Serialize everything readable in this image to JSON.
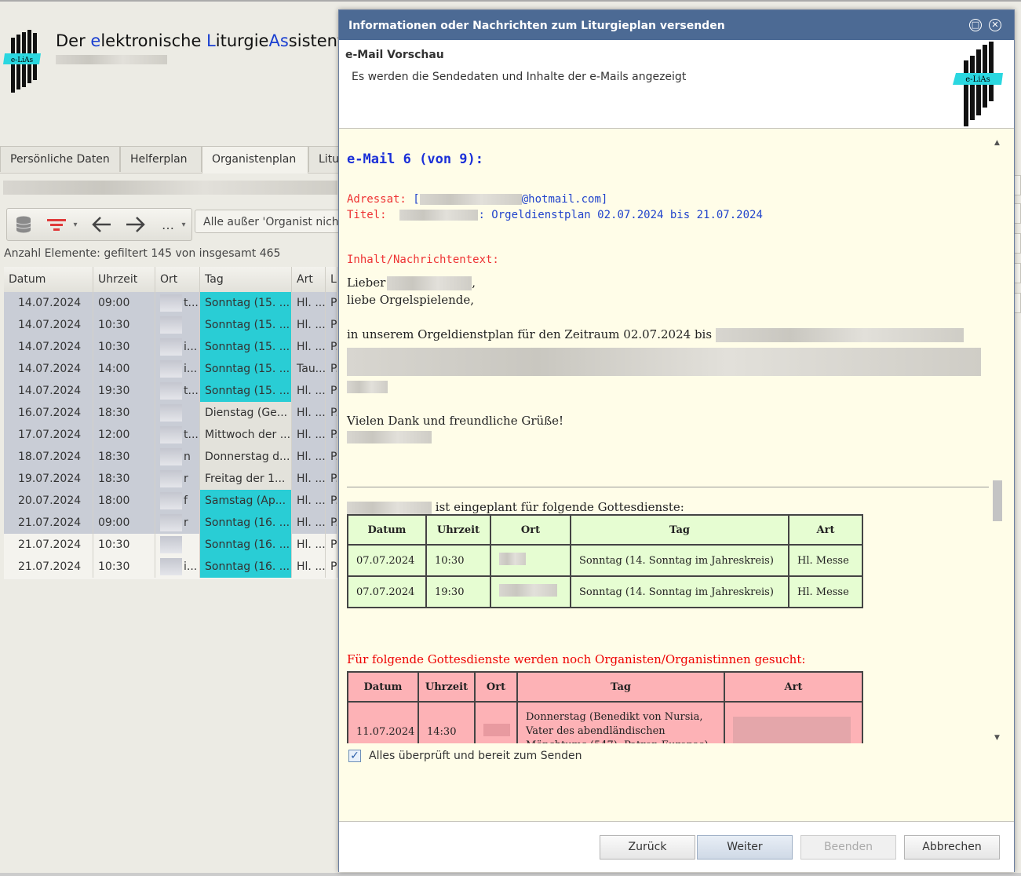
{
  "app": {
    "title_parts": [
      "Der ",
      "e",
      "lektronische ",
      "L",
      "iturgie",
      "As",
      "sistent"
    ],
    "logo_text": "e-LiAs"
  },
  "tabs": [
    "Persönliche Daten",
    "Helferplan",
    "Organistenplan",
    "Litu"
  ],
  "filter_text": "Alle außer 'Organist nich",
  "count_text": "Anzahl Elemente: gefiltert 145 von insgesamt 465",
  "grid": {
    "columns": [
      "Datum",
      "Uhrzeit",
      "Ort",
      "Tag",
      "Art",
      "Li"
    ],
    "rows": [
      {
        "datum": "14.07.2024",
        "uhrzeit": "09:00",
        "ort": "t...",
        "tag": "Sonntag (15. ...",
        "art": "Hl. ...",
        "li": "Pf"
      },
      {
        "datum": "14.07.2024",
        "uhrzeit": "10:30",
        "ort": "",
        "tag": "Sonntag (15. ...",
        "art": "Hl. ...",
        "li": "Pf"
      },
      {
        "datum": "14.07.2024",
        "uhrzeit": "10:30",
        "ort": "i...",
        "tag": "Sonntag (15. ...",
        "art": "Hl. ...",
        "li": "P."
      },
      {
        "datum": "14.07.2024",
        "uhrzeit": "14:00",
        "ort": "i...",
        "tag": "Sonntag (15. ...",
        "art": "Tau...",
        "li": "P."
      },
      {
        "datum": "14.07.2024",
        "uhrzeit": "19:30",
        "ort": "t...",
        "tag": "Sonntag (15. ...",
        "art": "Hl. ...",
        "li": "Pf"
      },
      {
        "datum": "16.07.2024",
        "uhrzeit": "18:30",
        "ort": "",
        "tag": "Dienstag (Ge...",
        "art": "Hl. ...",
        "li": "P."
      },
      {
        "datum": "17.07.2024",
        "uhrzeit": "12:00",
        "ort": "t...",
        "tag": "Mittwoch der ...",
        "art": "Hl. ...",
        "li": "P."
      },
      {
        "datum": "18.07.2024",
        "uhrzeit": "18:30",
        "ort": "n",
        "tag": "Donnerstag d...",
        "art": "Hl. ...",
        "li": "P."
      },
      {
        "datum": "19.07.2024",
        "uhrzeit": "18:30",
        "ort": "r",
        "tag": "Freitag der 1...",
        "art": "Hl. ...",
        "li": "P."
      },
      {
        "datum": "20.07.2024",
        "uhrzeit": "18:00",
        "ort": "f",
        "tag": "Samstag (Ap...",
        "art": "Hl. ...",
        "li": "P."
      },
      {
        "datum": "21.07.2024",
        "uhrzeit": "09:00",
        "ort": "r",
        "tag": "Sonntag (16. ...",
        "art": "Hl. ...",
        "li": "P."
      },
      {
        "datum": "21.07.2024",
        "uhrzeit": "10:30",
        "ort": "",
        "tag": "Sonntag (16. ...",
        "art": "Hl. ...",
        "li": "Pf"
      },
      {
        "datum": "21.07.2024",
        "uhrzeit": "10:30",
        "ort": "i...",
        "tag": "Sonntag (16. ...",
        "art": "Hl. ...",
        "li": "Pf"
      }
    ]
  },
  "dialog": {
    "title": "Informationen oder Nachrichten zum Liturgieplan versenden",
    "preview_title": "e-Mail Vorschau",
    "preview_sub": "Es werden die Sendedaten und Inhalte der e-Mails angezeigt",
    "logo_text": "e-LiAs",
    "checkbox_label": "Alles überprüft und bereit zum Senden",
    "buttons": {
      "back": "Zurück",
      "next": "Weiter",
      "finish": "Beenden",
      "cancel": "Abbrechen"
    }
  },
  "mail": {
    "heading": "e-Mail 6 (von 9):",
    "adressat_label": "Adressat:",
    "adressat_value": "@hotmail.com]",
    "titel_label": "Titel:",
    "titel_value": ": Orgeldienstplan 02.07.2024 bis 21.07.2024",
    "inhalt_label": "Inhalt/Nachrichtentext:",
    "greeting1": "Lieber",
    "greeting2": "liebe Orgelspielende,",
    "body_line": "in unserem Orgeldienstplan für den Zeitraum 02.07.2024 bis",
    "closing": "Vielen Dank und freundliche Grüße!",
    "scheduled_text": "ist eingeplant für folgende Gottesdienste:",
    "green_table": {
      "headers": [
        "Datum",
        "Uhrzeit",
        "Ort",
        "Tag",
        "Art"
      ],
      "rows": [
        [
          "07.07.2024",
          "10:30",
          "",
          "Sonntag (14. Sonntag im Jahreskreis)",
          "Hl. Messe"
        ],
        [
          "07.07.2024",
          "19:30",
          "",
          "Sonntag (14. Sonntag im Jahreskreis)",
          "Hl. Messe"
        ]
      ]
    },
    "red_heading": "Für folgende Gottesdienste werden noch Organisten/Organistinnen gesucht:",
    "red_table": {
      "headers": [
        "Datum",
        "Uhrzeit",
        "Ort",
        "Tag",
        "Art"
      ],
      "rows": [
        [
          "11.07.2024",
          "14:30",
          "",
          "Donnerstag (Benedikt von Nursia, Vater des abendländischen Mönchtums (547), Patron Europas)",
          ""
        ]
      ]
    }
  },
  "colors": {
    "accent": "#4c6a94",
    "cyan": "#29cdd5",
    "green_table": "#e6fdd2",
    "red_table": "#fdb2b6"
  }
}
